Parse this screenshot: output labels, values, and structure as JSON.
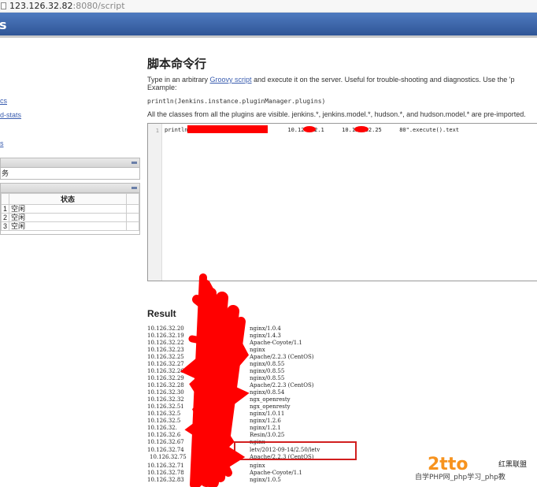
{
  "browser": {
    "url_host": "123.126.32.82",
    "url_rest": ":8080/script"
  },
  "header": {
    "brand_fragment": "s"
  },
  "sidebar": {
    "links": [
      "cs",
      "d-stats",
      "s"
    ],
    "build_queue": {
      "item": "务"
    },
    "executors": {
      "status_header": "状态",
      "rows": [
        {
          "num": "1",
          "status": "空闲"
        },
        {
          "num": "2",
          "status": "空闲"
        },
        {
          "num": "3",
          "status": "空闲"
        }
      ]
    }
  },
  "main": {
    "title": "脚本命令行",
    "intro_before": "Type in an arbitrary ",
    "intro_link": "Groovy script",
    "intro_after": " and execute it on the server. Useful for trouble-shooting and diagnostics. Use the 'p",
    "example_label": "Example:",
    "example_code": "println(Jenkins.instance.pluginManager.plugins)",
    "classes_sentence": "All the classes from all the plugins are visible. jenkins.*, jenkins.model.*, hudson.*, and hudson.model.* are pre-imported."
  },
  "editor": {
    "line_number": "1",
    "code_start": "println \"",
    "code_part2": "10.126.32.1",
    "code_part3": "10.126.32.25",
    "code_end": "80\".execute().text"
  },
  "result": {
    "title": "Result",
    "lines": [
      {
        "ip": "10.126.32.20",
        "server": "nginx/1.0.4"
      },
      {
        "ip": "10.126.32.19",
        "server": "nginx/1.4.3"
      },
      {
        "ip": "10.126.32.22",
        "server": "Apache-Coyote/1.1"
      },
      {
        "ip": "10.126.32.23",
        "server": "nginx"
      },
      {
        "ip": "10.126.32.25",
        "server": "Apache/2.2.3 (CentOS)"
      },
      {
        "ip": "10.126.32.27",
        "server": "nginx/0.8.55"
      },
      {
        "ip": "10.126.32.26",
        "server": "nginx/0.8.55"
      },
      {
        "ip": "10.126.32.29",
        "server": "nginx/0.8.55"
      },
      {
        "ip": "10.126.32.28",
        "server": "Apache/2.2.3 (CentOS)"
      },
      {
        "ip": "10.126.32.30",
        "server": "nginx/0.8.54"
      },
      {
        "ip": "10.126.32.32",
        "server": "ngx_openresty"
      },
      {
        "ip": "10.126.32.51",
        "server": "ngx_openresty"
      },
      {
        "ip": "10.126.32.5",
        "server": "nginx/1.0.11"
      },
      {
        "ip": "10.126.32.5",
        "server": "nginx/1.2.6"
      },
      {
        "ip": "10.126.32.",
        "server": "nginx/1.2.1"
      },
      {
        "ip": "10.126.32.6",
        "server": "Resin/3.0.25"
      },
      {
        "ip": "10.126.32.67",
        "server": "nginx"
      },
      {
        "ip": "10.126.32.74",
        "server": "letv/2012-09-14/2.50/letv"
      },
      {
        "ip": "10.126.32.75",
        "server": "Apache/2.2.3 (CentOS)"
      },
      {
        "ip": "10.126.32.71",
        "server": "nginx"
      },
      {
        "ip": "10.126.32.78",
        "server": "Apache-Coyote/1.1"
      },
      {
        "ip": "10.126.32.83",
        "server": "nginx/1.0.5"
      }
    ]
  },
  "watermark": {
    "logo_text": "红黑联盟",
    "footer_text": "自学PHP网_php学习_php教"
  },
  "colors": {
    "header_blue": "#2f5596",
    "link_blue": "#3b5eb0",
    "redaction_red": "#ff0000",
    "highlight_red": "#d11f1f",
    "watermark_orange": "#f7931e"
  }
}
